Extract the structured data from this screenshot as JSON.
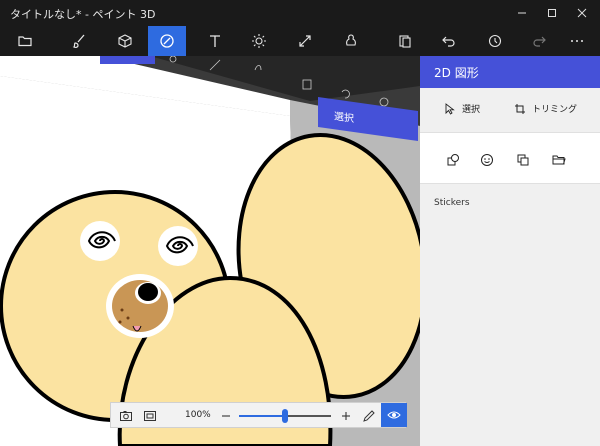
{
  "app": {
    "title": "タイトルなし* - ペイント 3D"
  },
  "window_controls": [
    {
      "name": "minimize-button",
      "icon": "minimize-icon"
    },
    {
      "name": "maximize-button",
      "icon": "maximize-icon"
    },
    {
      "name": "close-button",
      "icon": "close-icon"
    }
  ],
  "toolbar": {
    "tools": [
      {
        "name": "menu",
        "icon": "folder-icon"
      },
      {
        "name": "brushes",
        "icon": "brush-icon"
      },
      {
        "name": "3d-shapes",
        "icon": "cube-icon"
      },
      {
        "name": "2d-shapes",
        "icon": "shape-icon",
        "active": true
      },
      {
        "name": "text",
        "icon": "text-icon"
      },
      {
        "name": "effects",
        "icon": "sun-icon"
      },
      {
        "name": "canvas",
        "icon": "resize-icon"
      },
      {
        "name": "3d-library",
        "icon": "library-icon"
      },
      {
        "name": "paste",
        "icon": "paste-icon"
      },
      {
        "name": "undo",
        "icon": "undo-icon"
      },
      {
        "name": "history",
        "icon": "history-icon"
      },
      {
        "name": "redo",
        "icon": "redo-icon",
        "disabled": true
      },
      {
        "name": "more",
        "icon": "more-icon"
      }
    ],
    "colors": {
      "active_bg": "#2e6be0"
    }
  },
  "panel": {
    "title": "2D 図形",
    "select_label": "選択",
    "crop_label": "トリミング",
    "section_label": "Stickers",
    "icons": [
      "shapes-sticker-icon",
      "face-sticker-icon",
      "texture-sticker-icon",
      "folder-open-icon"
    ],
    "colors": {
      "header_bg": "#4551d8"
    }
  },
  "ghost_ui": {
    "select_label": "選択"
  },
  "bottom_bar": {
    "zoom_label": "100%",
    "zoom_fraction": 0.5,
    "icons": [
      "camera-icon",
      "fit-icon",
      "minus-icon",
      "plus-icon",
      "pencil-icon",
      "eye-icon"
    ]
  }
}
